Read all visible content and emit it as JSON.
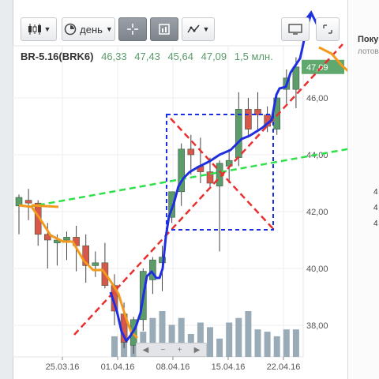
{
  "toolbar": {
    "interval_label": "день",
    "buttons": [
      "candles-icon",
      "clock-icon",
      "crosshair-icon",
      "chart-frame-icon",
      "indicator-icon"
    ]
  },
  "instrument": {
    "name": "BR-5.16(BRK6)",
    "open": "46,33",
    "high": "47,43",
    "low": "45,64",
    "close": "47,09",
    "volume": "1,5 млн."
  },
  "price_badge": "47,09",
  "right_panel": {
    "title": "Поку",
    "subtitle": "лотов",
    "values": [
      "4",
      "4",
      "4"
    ]
  },
  "colors": {
    "up_candle": "#5c9c6a",
    "down_candle": "#d8574b",
    "volume": "#9aabb8",
    "blue_line": "#1f2fe0",
    "orange_line": "#f39a1c",
    "red_dashed": "#e8302e",
    "green_dashed": "#2fe04a",
    "blue_box": "#1a2ee8",
    "badge": "#5fa86e"
  },
  "chart_data": {
    "type": "candlestick",
    "y_ticks": [
      "46,00",
      "44,00",
      "42,00",
      "40,00",
      "38,00"
    ],
    "x_ticks": [
      "25.03.16",
      "01.04.16",
      "08.04.16",
      "15.04.16",
      "22.04.16"
    ],
    "ylim": [
      37.0,
      48.4
    ],
    "candles": [
      {
        "o": 42.2,
        "h": 42.6,
        "l": 41.2,
        "c": 42.5
      },
      {
        "o": 42.4,
        "h": 42.8,
        "l": 41.7,
        "c": 42.3
      },
      {
        "o": 42.3,
        "h": 42.4,
        "l": 40.8,
        "c": 41.2
      },
      {
        "o": 41.2,
        "h": 41.6,
        "l": 40.0,
        "c": 41.0
      },
      {
        "o": 40.9,
        "h": 41.2,
        "l": 40.1,
        "c": 41.0
      },
      {
        "o": 41.0,
        "h": 41.3,
        "l": 40.3,
        "c": 41.1
      },
      {
        "o": 41.1,
        "h": 41.5,
        "l": 39.9,
        "c": 40.8
      },
      {
        "o": 40.8,
        "h": 41.2,
        "l": 39.5,
        "c": 40.1
      },
      {
        "o": 40.1,
        "h": 40.6,
        "l": 39.7,
        "c": 40.2
      },
      {
        "o": 40.2,
        "h": 40.9,
        "l": 39.3,
        "c": 39.4
      },
      {
        "o": 39.4,
        "h": 39.8,
        "l": 38.0,
        "c": 38.5
      },
      {
        "o": 38.4,
        "h": 38.8,
        "l": 37.2,
        "c": 37.4
      },
      {
        "o": 37.3,
        "h": 38.3,
        "l": 37.0,
        "c": 38.2
      },
      {
        "o": 38.2,
        "h": 40.0,
        "l": 37.8,
        "c": 39.9
      },
      {
        "o": 39.6,
        "h": 40.4,
        "l": 39.1,
        "c": 40.3
      },
      {
        "o": 40.2,
        "h": 40.8,
        "l": 39.2,
        "c": 40.4
      },
      {
        "o": 41.8,
        "h": 42.7,
        "l": 41.6,
        "c": 42.7
      },
      {
        "o": 42.7,
        "h": 44.4,
        "l": 42.2,
        "c": 44.2
      },
      {
        "o": 44.2,
        "h": 44.7,
        "l": 43.3,
        "c": 44.0
      },
      {
        "o": 43.6,
        "h": 44.6,
        "l": 43.0,
        "c": 43.4
      },
      {
        "o": 43.4,
        "h": 43.9,
        "l": 42.8,
        "c": 43.0
      },
      {
        "o": 42.9,
        "h": 43.8,
        "l": 40.6,
        "c": 43.7
      },
      {
        "o": 43.6,
        "h": 44.2,
        "l": 43.0,
        "c": 43.8
      },
      {
        "o": 43.9,
        "h": 46.2,
        "l": 43.6,
        "c": 45.6
      },
      {
        "o": 45.6,
        "h": 46.0,
        "l": 44.6,
        "c": 44.9
      },
      {
        "o": 45.6,
        "h": 46.2,
        "l": 44.8,
        "c": 45.4
      },
      {
        "o": 45.4,
        "h": 45.7,
        "l": 44.8,
        "c": 45.0
      },
      {
        "o": 44.9,
        "h": 46.1,
        "l": 44.7,
        "c": 46.0
      },
      {
        "o": 46.3,
        "h": 47.0,
        "l": 45.8,
        "c": 46.7
      },
      {
        "o": 46.3,
        "h": 47.43,
        "l": 45.64,
        "c": 47.09
      }
    ],
    "volumes": [
      0,
      0,
      0,
      0,
      0,
      0,
      0,
      0,
      0,
      0,
      18,
      26,
      32,
      22,
      34,
      40,
      28,
      34,
      20,
      30,
      26,
      16,
      30,
      34,
      40,
      24,
      22,
      18,
      24,
      24
    ],
    "volume_max": 40
  }
}
